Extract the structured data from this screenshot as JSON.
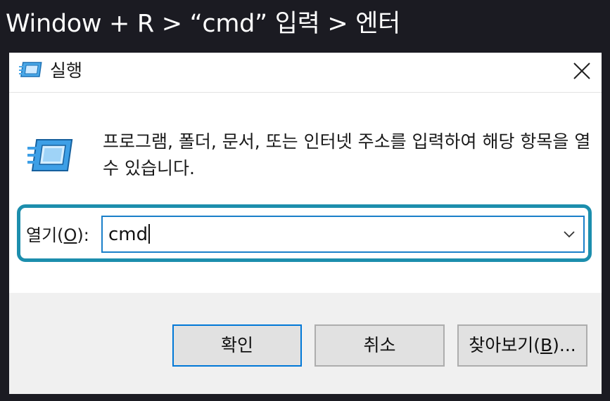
{
  "caption": "Window + R > “cmd” 입력 > 엔터",
  "dialog": {
    "title": "실행",
    "close_icon": "close-icon",
    "app_icon": "run-icon",
    "description": "프로그램, 폴더, 문서, 또는 인터넷 주소를 입력하여 해당 항목을 열 수 있습니다.",
    "open_label_prefix": "열기(",
    "open_label_accel": "O",
    "open_label_suffix": "):",
    "open_value": "cmd",
    "highlight_color": "#1c8ead",
    "buttons": {
      "ok": "확인",
      "cancel": "취소",
      "browse_prefix": "찾아보기(",
      "browse_accel": "B",
      "browse_suffix": ")..."
    }
  }
}
